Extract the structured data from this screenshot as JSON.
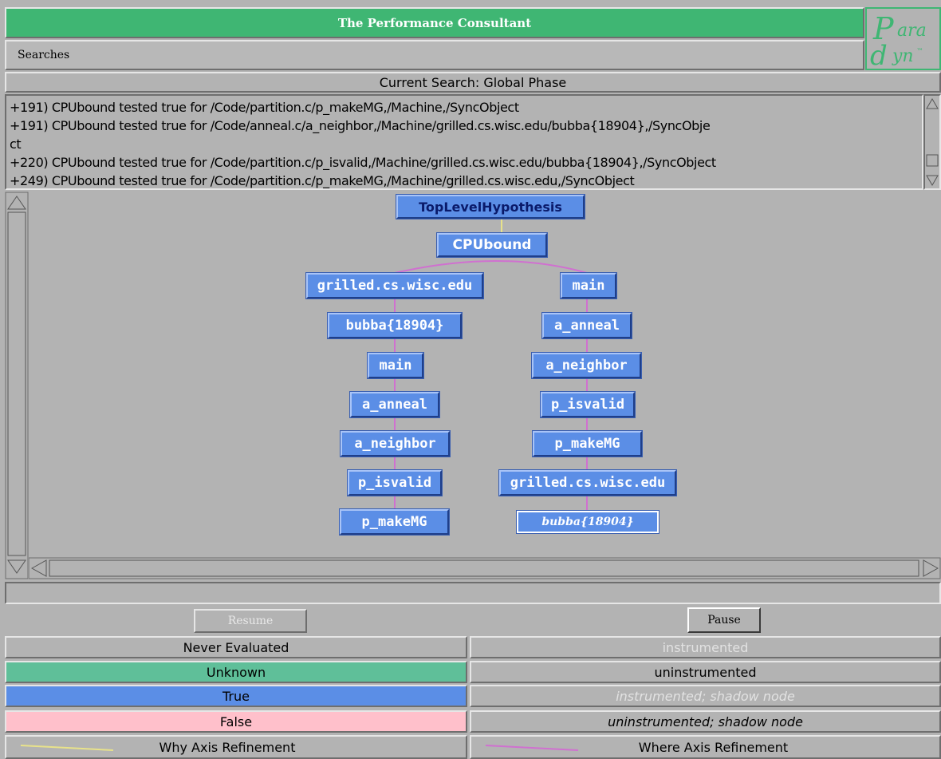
{
  "window": {
    "title": "The Performance Consultant"
  },
  "menu": {
    "searches_label": "Searches"
  },
  "logo": {
    "top_text": "ara",
    "bottom_text": "yn",
    "tm": "™"
  },
  "current_search": {
    "label": "Current Search:  Global Phase"
  },
  "log_lines": [
    "+191) CPUbound tested true for /Code/partition.c/p_makeMG,/Machine,/SyncObject",
    "+191) CPUbound tested true for /Code/anneal.c/a_neighbor,/Machine/grilled.cs.wisc.edu/bubba{18904},/SyncObje",
    "ct",
    "+220) CPUbound tested true for /Code/partition.c/p_isvalid,/Machine/grilled.cs.wisc.edu/bubba{18904},/SyncObject",
    "+249) CPUbound tested true for /Code/partition.c/p_makeMG,/Machine/grilled.cs.wisc.edu,/SyncObject"
  ],
  "tree": {
    "root": "TopLevelHypothesis",
    "cpu": "CPUbound",
    "left": [
      "grilled.cs.wisc.edu",
      "bubba{18904}",
      "main",
      "a_anneal",
      "a_neighbor",
      "p_isvalid",
      "p_makeMG"
    ],
    "right": [
      "main",
      "a_anneal",
      "a_neighbor",
      "p_isvalid",
      "p_makeMG",
      "grilled.cs.wisc.edu",
      "bubba{18904}"
    ]
  },
  "buttons": {
    "resume": "Resume",
    "pause": "Pause"
  },
  "legend": {
    "never_evaluated": "Never Evaluated",
    "unknown": "Unknown",
    "true_label": "True",
    "false_label": "False",
    "why_axis": "Why Axis Refinement",
    "instrumented": "instrumented",
    "uninstrumented": "uninstrumented",
    "instrumented_shadow": "instrumented; shadow node",
    "uninstrumented_shadow": "uninstrumented; shadow node",
    "where_axis": "Where Axis Refinement"
  },
  "colors": {
    "title_green": "#3fb673",
    "unknown_green": "#5fbf99",
    "true_blue": "#5b8ee6",
    "false_pink": "#ffc0cb",
    "why_line": "#e8e28a",
    "where_line": "#d070d0"
  }
}
